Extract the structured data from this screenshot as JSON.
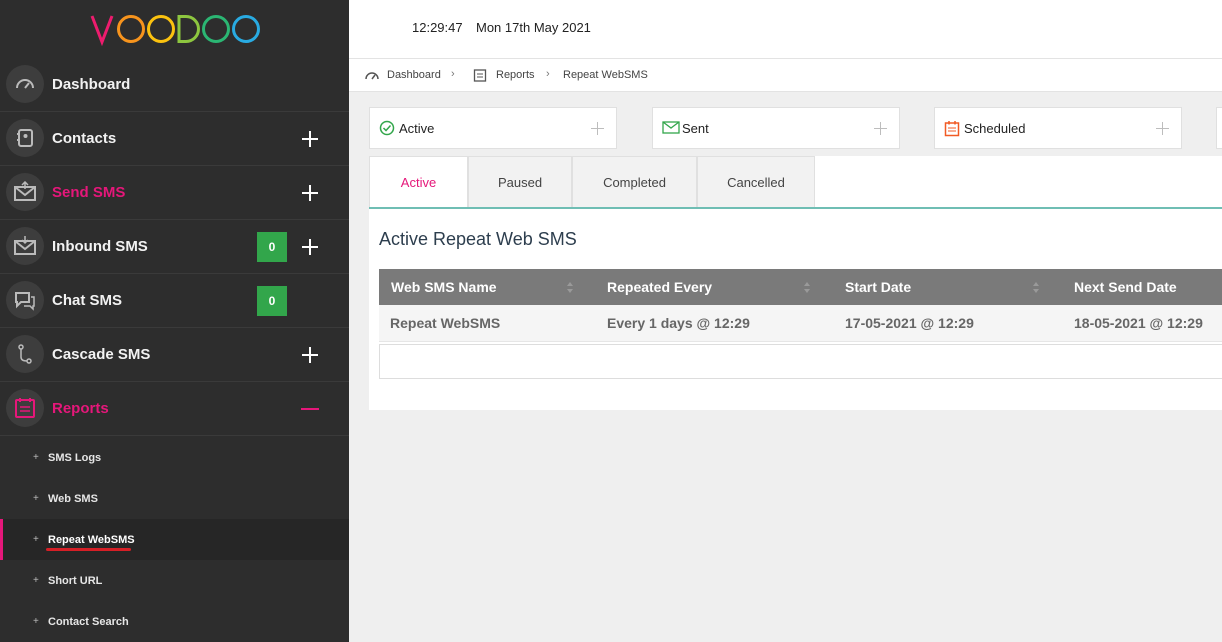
{
  "logo": {
    "letters": [
      "V",
      "O",
      "O",
      "D",
      "O",
      "O"
    ],
    "colors": [
      "#ed1c6e",
      "#f7941d",
      "#fbc20f",
      "#8dc63f",
      "#2bb673",
      "#29abe2"
    ]
  },
  "sidebar": {
    "items": [
      {
        "label": "Dashboard"
      },
      {
        "label": "Contacts"
      },
      {
        "label": "Send SMS"
      },
      {
        "label": "Inbound SMS",
        "badge": "0"
      },
      {
        "label": "Chat SMS",
        "badge": "0"
      },
      {
        "label": "Cascade SMS"
      },
      {
        "label": "Reports"
      }
    ],
    "sub_items": [
      {
        "prefix": "+",
        "label": "SMS Logs"
      },
      {
        "prefix": "+",
        "label": "Web SMS"
      },
      {
        "prefix": "+",
        "label": "Repeat WebSMS"
      },
      {
        "prefix": "+",
        "label": "Short URL"
      },
      {
        "prefix": "+",
        "label": "Contact Search"
      }
    ]
  },
  "header": {
    "time": "12:29:47",
    "date": "Mon 17th May 2021"
  },
  "breadcrumb": [
    "Dashboard",
    "Reports",
    "Repeat WebSMS"
  ],
  "cards": [
    {
      "label": "Active"
    },
    {
      "label": "Sent"
    },
    {
      "label": "Scheduled"
    }
  ],
  "tabs": [
    "Active",
    "Paused",
    "Completed",
    "Cancelled"
  ],
  "main": {
    "title": "Active Repeat Web SMS"
  },
  "table": {
    "columns": [
      "Web SMS Name",
      "Repeated Every",
      "Start Date",
      "Next Send Date"
    ],
    "rows": [
      [
        "Repeat WebSMS",
        "Every 1 days @ 12:29",
        "17-05-2021 @ 12:29",
        "18-05-2021 @ 12:29"
      ]
    ]
  },
  "colors": {
    "accent": "#e5177a",
    "sidebar": "#2d2d2d",
    "badge": "#32a64b",
    "tab_border": "#6fbeb4"
  }
}
